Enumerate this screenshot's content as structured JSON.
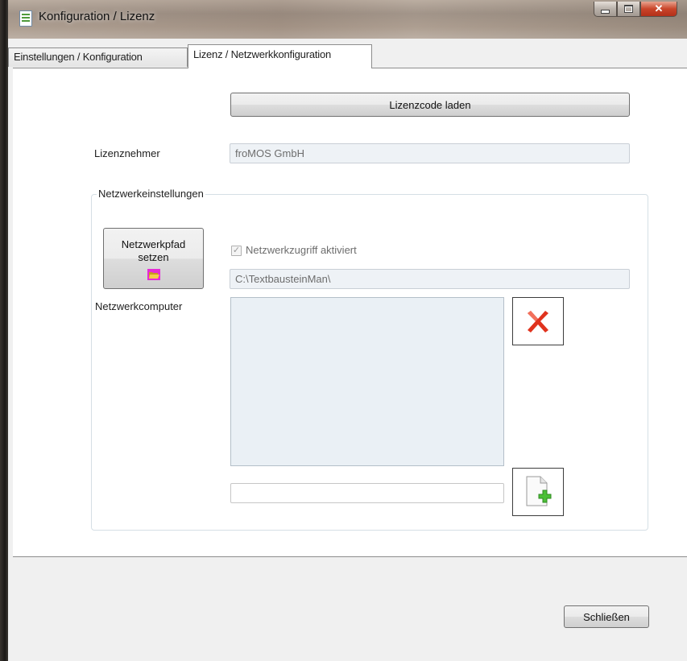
{
  "window": {
    "title": "Konfiguration / Lizenz"
  },
  "tabs": [
    {
      "label": "Einstellungen / Konfiguration",
      "active": false
    },
    {
      "label": "Lizenz / Netzwerkkonfiguration",
      "active": true
    }
  ],
  "license": {
    "load_button_label": "Lizenzcode laden",
    "licensee_label": "Lizenznehmer",
    "licensee_value": "froMOS GmbH"
  },
  "network": {
    "group_title": "Netzwerkeinstellungen",
    "set_path_button_label_line1": "Netzwerkpfad",
    "set_path_button_label_line2": "setzen",
    "access_checkbox_label": "Netzwerkzugriff aktiviert",
    "access_checked": true,
    "path_value": "C:\\TextbausteinMan\\",
    "computers_label": "Netzwerkcomputer",
    "computers": [],
    "new_computer_value": ""
  },
  "icons": {
    "folder": "folder-icon",
    "delete": "red-x-icon",
    "add": "document-plus-icon"
  },
  "footer": {
    "close_button_label": "Schließen"
  }
}
